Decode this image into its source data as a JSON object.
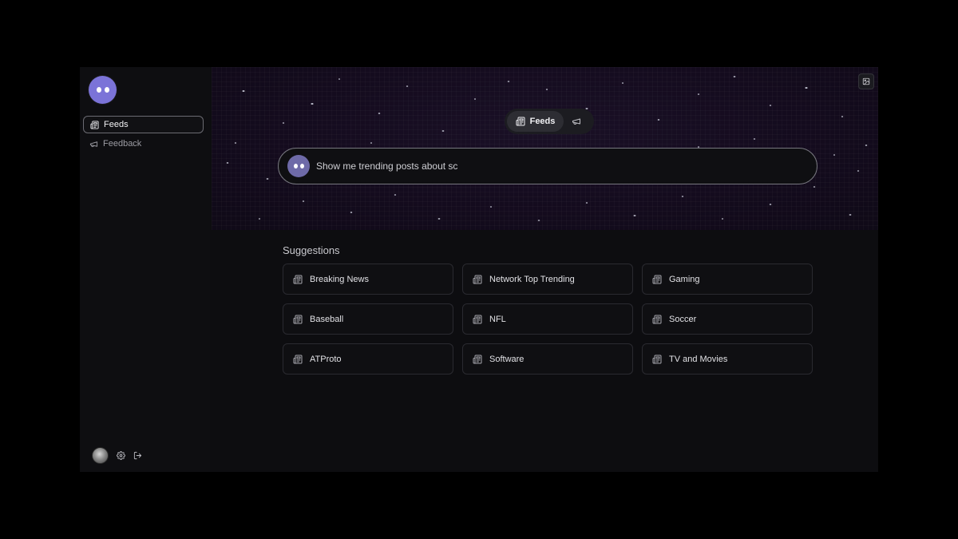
{
  "sidebar": {
    "items": [
      {
        "label": "Feeds",
        "icon": "newspaper-icon"
      },
      {
        "label": "Feedback",
        "icon": "megaphone-icon"
      }
    ]
  },
  "toggle": {
    "feeds_label": "Feeds"
  },
  "search": {
    "value": "Show me trending posts about sc"
  },
  "suggestions": {
    "title": "Suggestions",
    "items": [
      "Breaking News",
      "Network Top Trending",
      "Gaming",
      "Baseball",
      "NFL",
      "Soccer",
      "ATProto",
      "Software",
      "TV and Movies"
    ]
  },
  "colors": {
    "accent": "#7b73d8",
    "hero_bg": "#140b1e",
    "app_bg": "#0d0d10"
  }
}
